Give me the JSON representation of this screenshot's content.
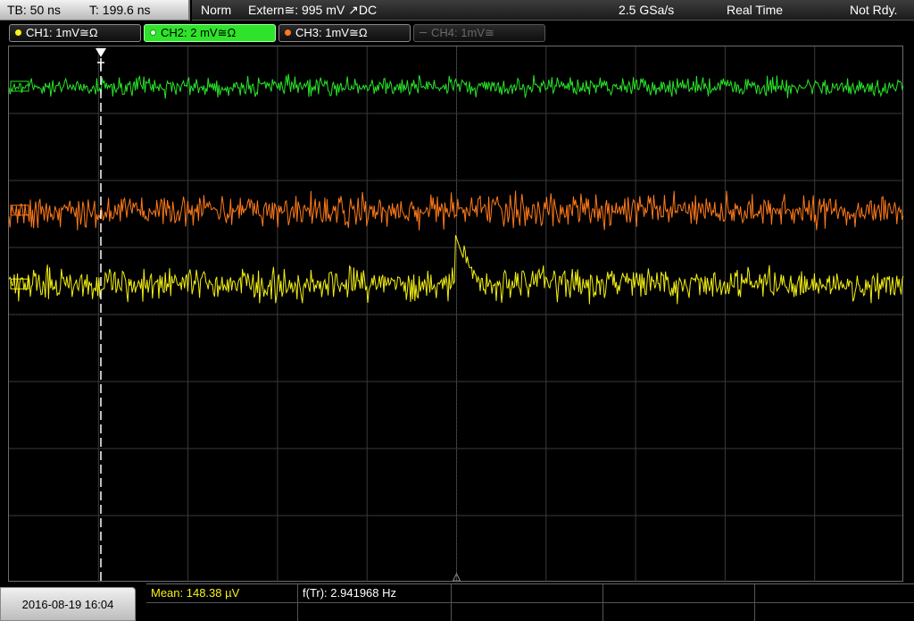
{
  "topbar": {
    "timebase": "TB: 50 ns",
    "trigger_time": "T: 199.6 ns",
    "mode": "Norm",
    "trigger_source": "Extern≅: 995 mV ↗DC",
    "sample_rate": "2.5 GSa/s",
    "acq_mode": "Real Time",
    "status": "Not Rdy."
  },
  "channels": [
    {
      "label": "CH1: 1mV≅Ω",
      "color": "#f7f21a",
      "state": "on"
    },
    {
      "label": "CH2: 2 mV≅Ω",
      "color": "#2ee32a",
      "state": "active"
    },
    {
      "label": "CH3: 1mV≅Ω",
      "color": "#ff7a1a",
      "state": "on"
    },
    {
      "label": "CH4: 1mV≅",
      "color": "#6a6a6a",
      "state": "off"
    }
  ],
  "traces": {
    "ch2": {
      "color": "#28e428",
      "baseline_div": 0.6,
      "noise_div": 0.2
    },
    "ch3": {
      "color": "#ff7a1a",
      "baseline_div": 2.45,
      "noise_div": 0.35
    },
    "ch1": {
      "color": "#f2ef12",
      "baseline_div": 3.55,
      "noise_div": 0.35
    }
  },
  "icons": {
    "trigger_marker": "trigger-position-arrow-icon",
    "ground_markers": "channel-ground-marker-icon"
  },
  "datetime": "2016-08-19 16:04",
  "measurements": {
    "mean": "Mean: 148.38 µV",
    "frequency": "f(Tr): 2.941968 Hz"
  }
}
